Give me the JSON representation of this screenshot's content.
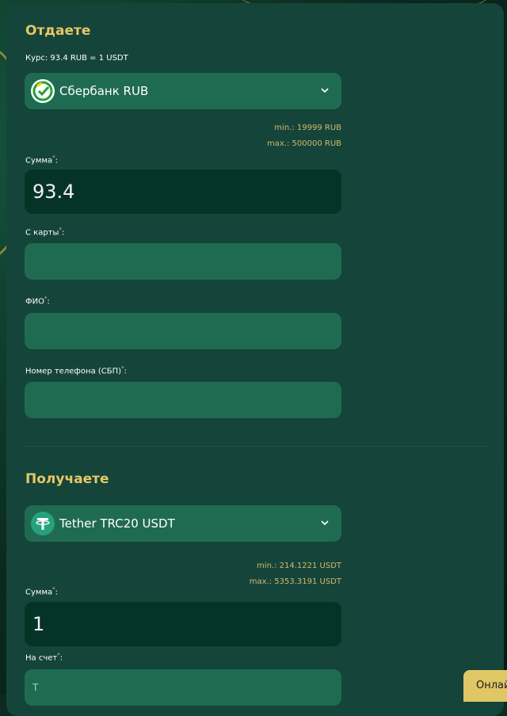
{
  "give": {
    "title": "Отдаете",
    "rate": "Курс: 93.4 RUB = 1 USDT",
    "currency": "Сбербанк RUB",
    "min": "min.: 19999 RUB",
    "max": "max.: 500000 RUB",
    "amount_label": "Сумма",
    "amount_value": "93.4",
    "card_label": "С карты",
    "card_value": "",
    "fio_label": "ФИО",
    "fio_value": "",
    "phone_label": "Номер телефона (СБП)",
    "phone_value": ""
  },
  "receive": {
    "title": "Получаете",
    "currency": "Tether TRC20 USDT",
    "min": "min.: 214.1221 USDT",
    "max": "max.: 5353.3191 USDT",
    "amount_label": "Сумма",
    "amount_value": "1",
    "account_label": "На счет",
    "account_value": "T"
  },
  "required_mark": "*",
  "chat_button": "Онлайн",
  "colors": {
    "accent": "#e6c765",
    "panel": "#15443a",
    "input": "#1f6b52",
    "amount_input": "#053426"
  },
  "icons": [
    "sberbank-logo-icon",
    "tether-icon",
    "chevron-down-icon"
  ]
}
